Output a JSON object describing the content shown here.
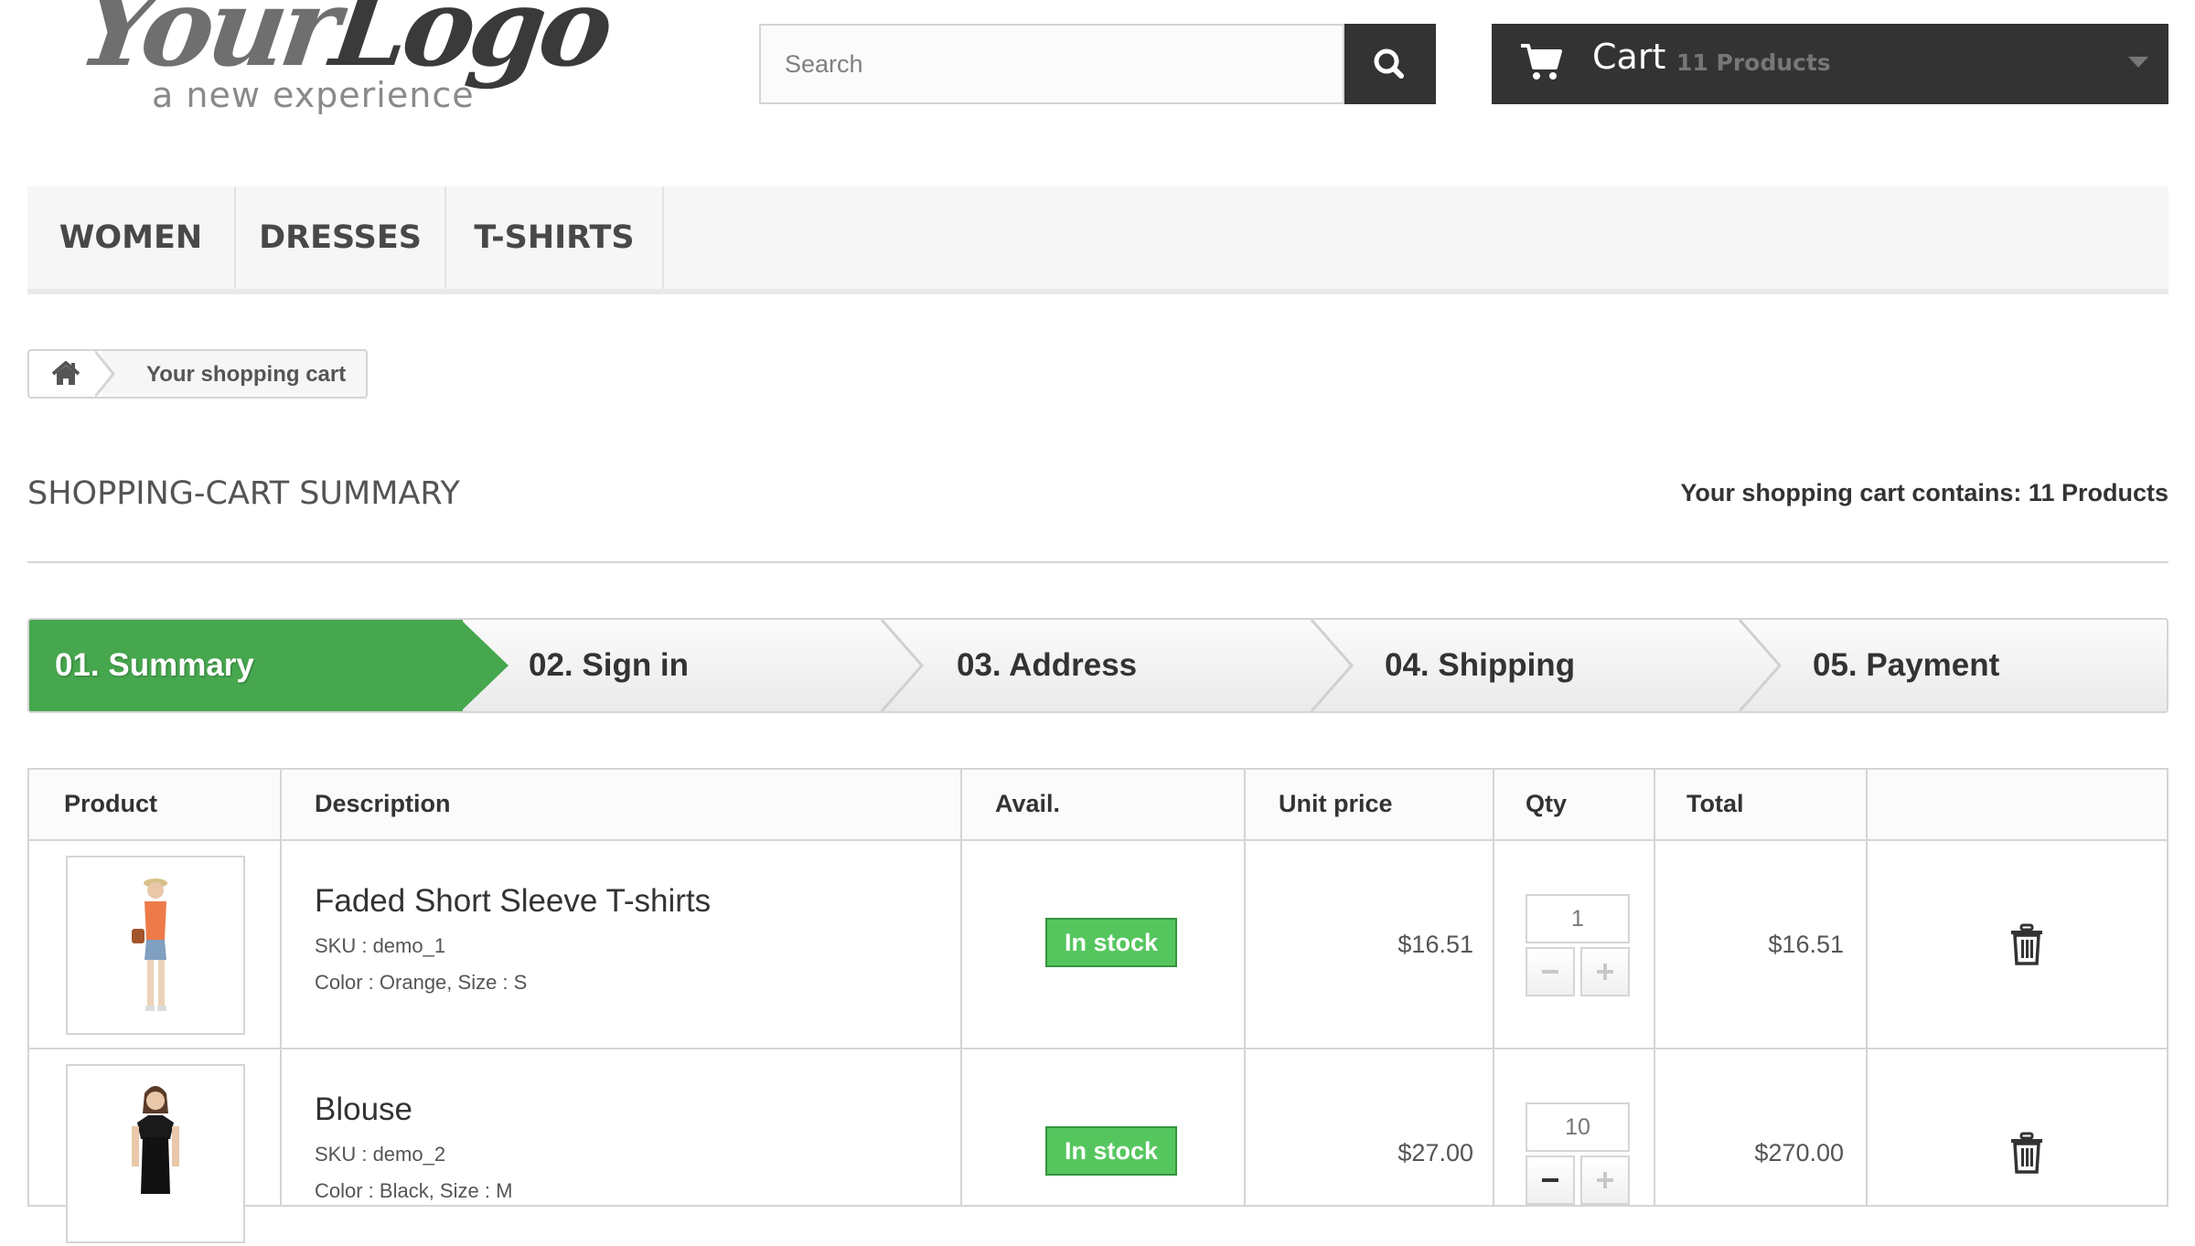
{
  "logo": {
    "main_a": "Your",
    "main_b": "Logo",
    "tagline": "a new experience"
  },
  "search": {
    "placeholder": "Search",
    "value": ""
  },
  "cart": {
    "title": "Cart",
    "count": "11 Products"
  },
  "menu": {
    "items": [
      {
        "label": "Women"
      },
      {
        "label": "Dresses"
      },
      {
        "label": "T-shirts"
      }
    ]
  },
  "breadcrumb": {
    "current": "Your shopping cart"
  },
  "page": {
    "title": "Shopping-cart summary",
    "contains": "Your shopping cart contains: 11 Products"
  },
  "steps": [
    {
      "label": "01. Summary",
      "active": true
    },
    {
      "label": "02. Sign in"
    },
    {
      "label": "03. Address"
    },
    {
      "label": "04. Shipping"
    },
    {
      "label": "05. Payment"
    }
  ],
  "table": {
    "headers": {
      "product": "Product",
      "description": "Description",
      "avail": "Avail.",
      "unit_price": "Unit price",
      "qty": "Qty",
      "total": "Total"
    },
    "rows": [
      {
        "name": "Faded Short Sleeve T-shirts",
        "sku": "SKU : demo_1",
        "attributes": "Color : Orange, Size : S",
        "availability": "In stock",
        "unit_price": "$16.51",
        "qty": "1",
        "total": "$16.51"
      },
      {
        "name": "Blouse",
        "sku": "SKU : demo_2",
        "attributes": "Color : Black, Size : M",
        "availability": "In stock",
        "unit_price": "$27.00",
        "qty": "10",
        "total": "$270.00"
      }
    ]
  },
  "colors": {
    "accent_green": "#46a74e",
    "stock_green": "#55c65e",
    "dark": "#333333"
  }
}
